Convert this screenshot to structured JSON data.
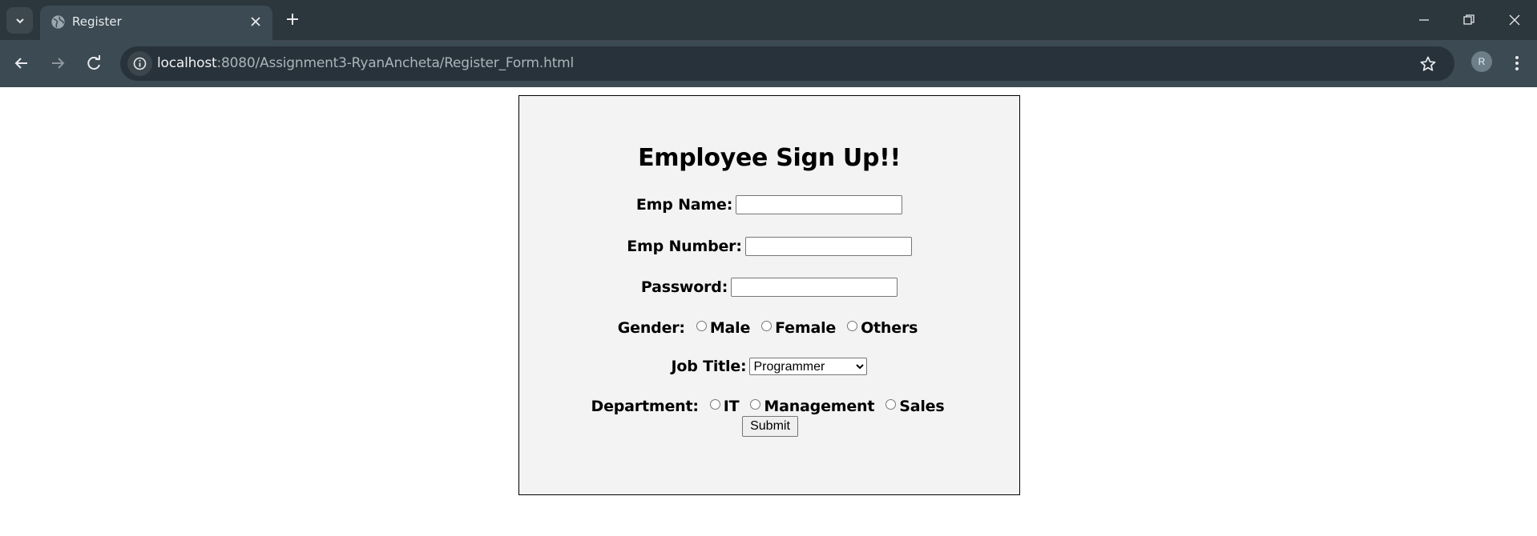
{
  "browser": {
    "tab_title": "Register",
    "url_host": "localhost",
    "url_rest": ":8080/Assignment3-RyanAncheta/Register_Form.html",
    "profile_initial": "R"
  },
  "form": {
    "title": "Employee Sign Up!!",
    "emp_name_label": "Emp Name:",
    "emp_name_value": "",
    "emp_number_label": "Emp Number:",
    "emp_number_value": "",
    "password_label": "Password:",
    "password_value": "",
    "gender_label": "Gender:",
    "gender_options": [
      "Male",
      "Female",
      "Others"
    ],
    "job_title_label": "Job Title:",
    "job_title_selected": "Programmer",
    "department_label": "Department:",
    "department_options": [
      "IT",
      "Management",
      "Sales"
    ],
    "submit_label": "Submit"
  }
}
